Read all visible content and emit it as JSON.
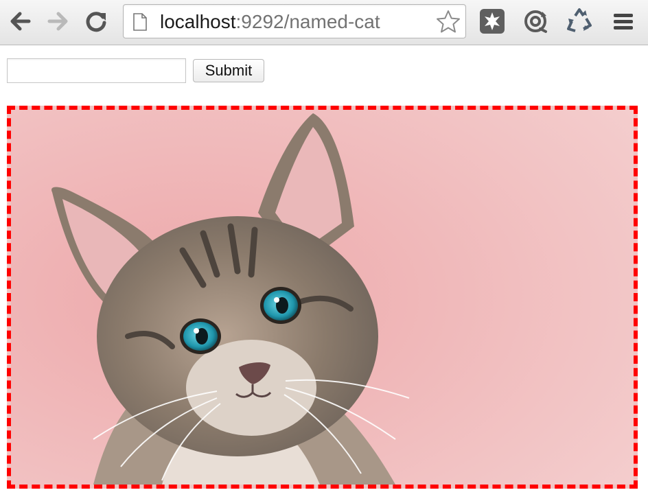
{
  "browser": {
    "url_host": "localhost",
    "url_rest": ":9292/named-cat",
    "icons": [
      "back-arrow-icon",
      "forward-arrow-icon",
      "reload-icon",
      "page-icon",
      "bookmark-star-icon",
      "extension-puzzle-icon",
      "sync-extension-icon",
      "recycle-extension-icon",
      "hamburger-menu-icon"
    ]
  },
  "form": {
    "input_value": "",
    "submit_label": "Submit"
  },
  "image": {
    "subject": "tabby kitten on pink background",
    "border_color": "#ff0000",
    "background_color": "#f0c4c3"
  }
}
